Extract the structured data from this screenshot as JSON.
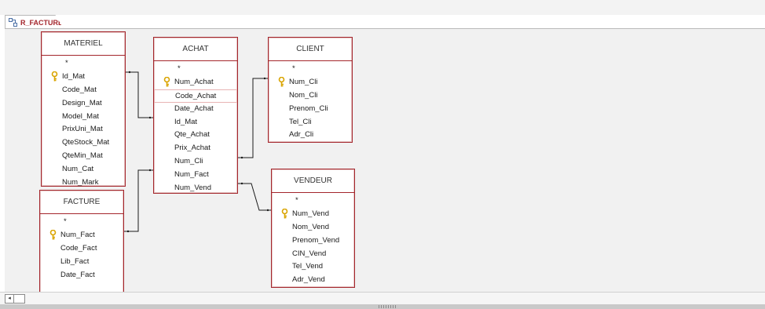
{
  "tab": {
    "label": "R_FACTURE",
    "icon": "relationships-icon"
  },
  "tables": {
    "materiel": {
      "title": "MATERIEL",
      "fields": [
        {
          "label": "*",
          "key": false
        },
        {
          "label": "Id_Mat",
          "key": true
        },
        {
          "label": "Code_Mat",
          "key": false
        },
        {
          "label": "Design_Mat",
          "key": false
        },
        {
          "label": "Model_Mat",
          "key": false
        },
        {
          "label": "PrixUni_Mat",
          "key": false
        },
        {
          "label": "QteStock_Mat",
          "key": false
        },
        {
          "label": "QteMin_Mat",
          "key": false
        },
        {
          "label": "Num_Cat",
          "key": false
        },
        {
          "label": "Num_Mark",
          "key": false
        }
      ]
    },
    "achat": {
      "title": "ACHAT",
      "fields": [
        {
          "label": "*",
          "key": false
        },
        {
          "label": "Num_Achat",
          "key": true
        },
        {
          "label": "Code_Achat",
          "key": false,
          "selected": true
        },
        {
          "label": "Date_Achat",
          "key": false
        },
        {
          "label": "Id_Mat",
          "key": false
        },
        {
          "label": "Qte_Achat",
          "key": false
        },
        {
          "label": "Prix_Achat",
          "key": false
        },
        {
          "label": "Num_Cli",
          "key": false
        },
        {
          "label": "Num_Fact",
          "key": false
        },
        {
          "label": "Num_Vend",
          "key": false
        }
      ]
    },
    "client": {
      "title": "CLIENT",
      "fields": [
        {
          "label": "*",
          "key": false
        },
        {
          "label": "Num_Cli",
          "key": true
        },
        {
          "label": "Nom_Cli",
          "key": false
        },
        {
          "label": "Prenom_Cli",
          "key": false
        },
        {
          "label": "Tel_Cli",
          "key": false
        },
        {
          "label": "Adr_Cli",
          "key": false
        }
      ]
    },
    "facture": {
      "title": "FACTURE",
      "fields": [
        {
          "label": "*",
          "key": false
        },
        {
          "label": "Num_Fact",
          "key": true
        },
        {
          "label": "Code_Fact",
          "key": false
        },
        {
          "label": "Lib_Fact",
          "key": false
        },
        {
          "label": "Date_Fact",
          "key": false
        }
      ]
    },
    "vendeur": {
      "title": "VENDEUR",
      "fields": [
        {
          "label": "*",
          "key": false
        },
        {
          "label": "Num_Vend",
          "key": true
        },
        {
          "label": "Nom_Vend",
          "key": false
        },
        {
          "label": "Prenom_Vend",
          "key": false
        },
        {
          "label": "CIN_Vend",
          "key": false
        },
        {
          "label": "Tel_Vend",
          "key": false
        },
        {
          "label": "Adr_Vend",
          "key": false
        }
      ]
    }
  },
  "colors": {
    "accent": "#a4262c",
    "key": "#d9a400",
    "canvas": "#f1f1f1"
  },
  "scrollbar": {
    "left_arrow": "◂"
  }
}
